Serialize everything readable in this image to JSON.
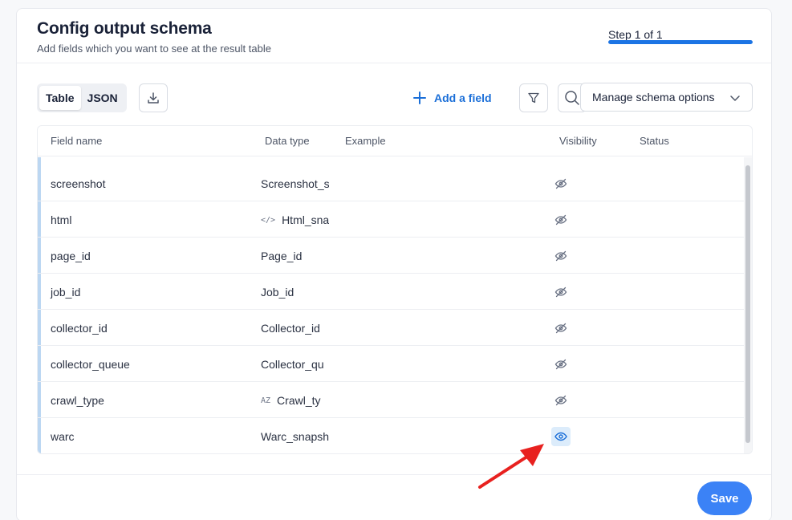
{
  "header": {
    "title": "Config output schema",
    "subtitle": "Add fields which you want to see at the result table",
    "step_label": "Step 1 of 1",
    "step_progress": 1.0
  },
  "toolbar": {
    "view_tabs": [
      "Table",
      "JSON"
    ],
    "active_tab": "Table",
    "add_field_label": "Add a field",
    "manage_label": "Manage schema options",
    "icons": [
      "download-icon",
      "filter-icon",
      "search-icon",
      "chevron-down-icon"
    ]
  },
  "table": {
    "columns": [
      "Field name",
      "Data type",
      "Example",
      "Visibility",
      "Status"
    ],
    "rows": [
      {
        "name": "screenshot",
        "type_icon": "",
        "type": "Screenshot_s",
        "visible": false
      },
      {
        "name": "html",
        "type_icon": "</>",
        "type": "Html_sna",
        "visible": false
      },
      {
        "name": "page_id",
        "type_icon": "",
        "type": "Page_id",
        "visible": false
      },
      {
        "name": "job_id",
        "type_icon": "",
        "type": "Job_id",
        "visible": false
      },
      {
        "name": "collector_id",
        "type_icon": "",
        "type": "Collector_id",
        "visible": false
      },
      {
        "name": "collector_queue",
        "type_icon": "",
        "type": "Collector_qu",
        "visible": false
      },
      {
        "name": "crawl_type",
        "type_icon": "AZ",
        "type": "Crawl_ty",
        "visible": false
      },
      {
        "name": "warc",
        "type_icon": "",
        "type": "Warc_snapsh",
        "visible": true
      }
    ]
  },
  "footer": {
    "save_label": "Save"
  },
  "colors": {
    "accent": "#1b74e4",
    "save_button": "#3b82f6",
    "annotation_arrow": "#e8211f"
  }
}
